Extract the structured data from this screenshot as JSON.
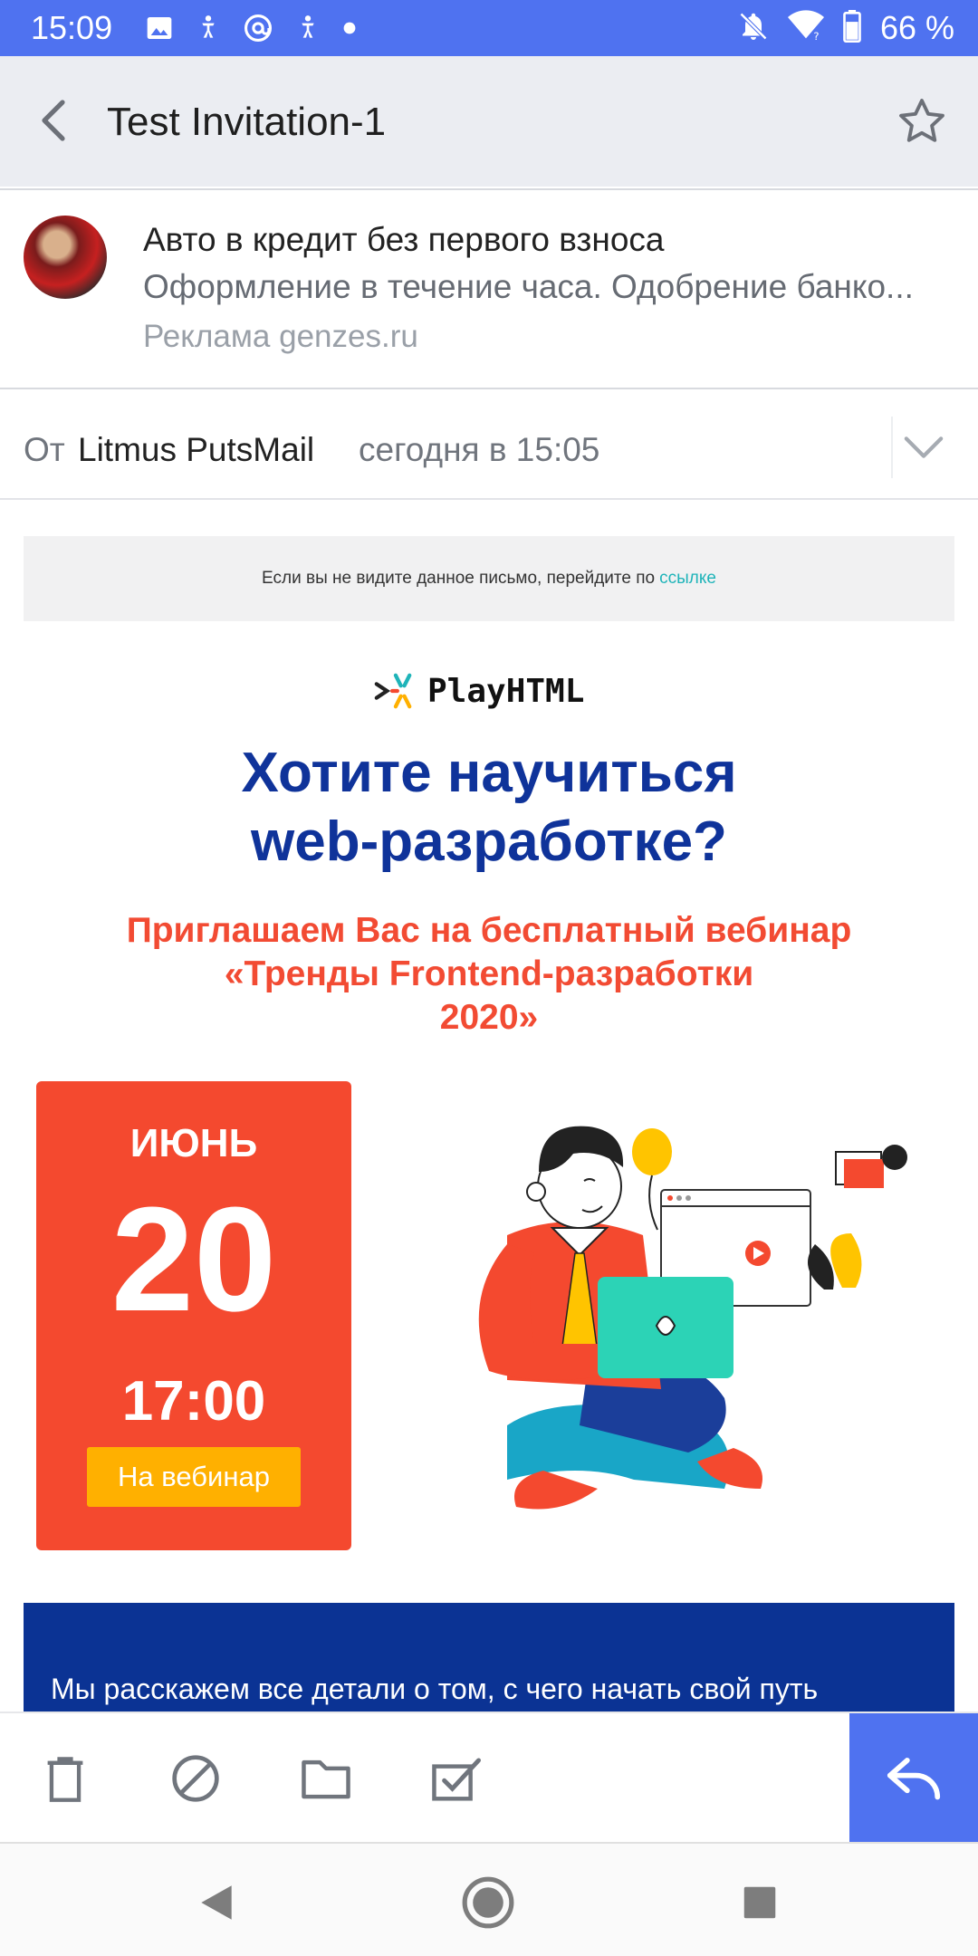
{
  "status_bar": {
    "time": "15:09",
    "battery": "66 %",
    "icons_left": [
      "image-icon",
      "accessibility-icon",
      "at-sign-icon",
      "accessibility-icon",
      "dot-icon"
    ],
    "icons_right": [
      "notifications-off-icon",
      "wifi-icon",
      "battery-icon"
    ]
  },
  "app_bar": {
    "title": "Test Invitation-1"
  },
  "ad": {
    "title": "Авто в кредит без первого взноса",
    "description": "Оформление в течение часа. Одобрение банко...",
    "source": "Реклама genzes.ru"
  },
  "message_header": {
    "from_label": "От",
    "sender": "Litmus PutsMail",
    "date": "сегодня в 15:05"
  },
  "email": {
    "preheader_text": "Если вы не видите данное письмо, перейдите по",
    "preheader_link": "ссылке",
    "logo_text": "PlayHTML",
    "headline_line1": "Хотите научиться",
    "headline_line2": "web-разработке?",
    "subhead_line1": "Приглашаем Вас на бесплатный вебинар",
    "subhead_line2": "«Тренды Frontend-разработки",
    "subhead_line3": "2020»",
    "date_card": {
      "month": "ИЮНЬ",
      "day": "20",
      "time": "17:00",
      "button": "На вебинар"
    },
    "blue_block_text": "Мы расскажем все детали о том, с чего начать свой путь"
  },
  "toolbar": {
    "items": [
      "trash-icon",
      "spam-icon",
      "folder-icon",
      "mark-read-icon"
    ],
    "reply": "reply-icon"
  },
  "colors": {
    "accent": "#4f72f0",
    "headline": "#0f339a",
    "subhead": "#f24b33",
    "date_card": "#f4492f",
    "cta": "#ffb000",
    "link": "#1fb4b9"
  }
}
